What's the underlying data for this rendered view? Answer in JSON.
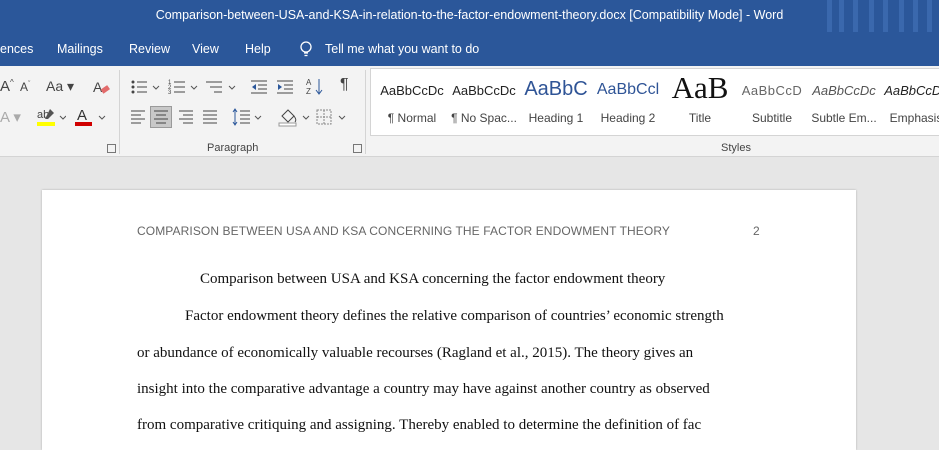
{
  "window": {
    "title": "Comparison-between-USA-and-KSA-in-relation-to-the-factor-endowment-theory.docx [Compatibility Mode]  -  Word"
  },
  "menu": {
    "items": [
      "ences",
      "Mailings",
      "Review",
      "View",
      "Help"
    ],
    "tell_me": "Tell me what you want to do"
  },
  "ribbon": {
    "groups": {
      "paragraph": "Paragraph",
      "styles": "Styles"
    },
    "styles": [
      {
        "preview": "AaBbCcDc",
        "name": "¶ Normal"
      },
      {
        "preview": "AaBbCcDc",
        "name": "¶ No Spac..."
      },
      {
        "preview": "AaBbC",
        "name": "Heading 1"
      },
      {
        "preview": "AaBbCcl",
        "name": "Heading 2"
      },
      {
        "preview": "AaB",
        "name": "Title"
      },
      {
        "preview": "AaBbCcD",
        "name": "Subtitle"
      },
      {
        "preview": "AaBbCcDc",
        "name": "Subtle Em..."
      },
      {
        "preview": "AaBbCcDc",
        "name": "Emphasis"
      }
    ],
    "colors": {
      "highlight": "#ffff00",
      "font_color": "#d00000"
    }
  },
  "document": {
    "header": "COMPARISON BETWEEN USA AND KSA CONCERNING THE FACTOR ENDOWMENT THEORY",
    "page_number": "2",
    "title": "Comparison between USA and KSA concerning the factor endowment theory",
    "lines": [
      "Factor endowment theory defines the relative comparison of countries’ economic strength",
      "or abundance of economically valuable recourses (Ragland et al., 2015). The theory gives an",
      "insight into the comparative advantage a country may have against another country as observed",
      "from comparative critiquing and assigning. Thereby enabled to determine the definition of fac"
    ]
  }
}
